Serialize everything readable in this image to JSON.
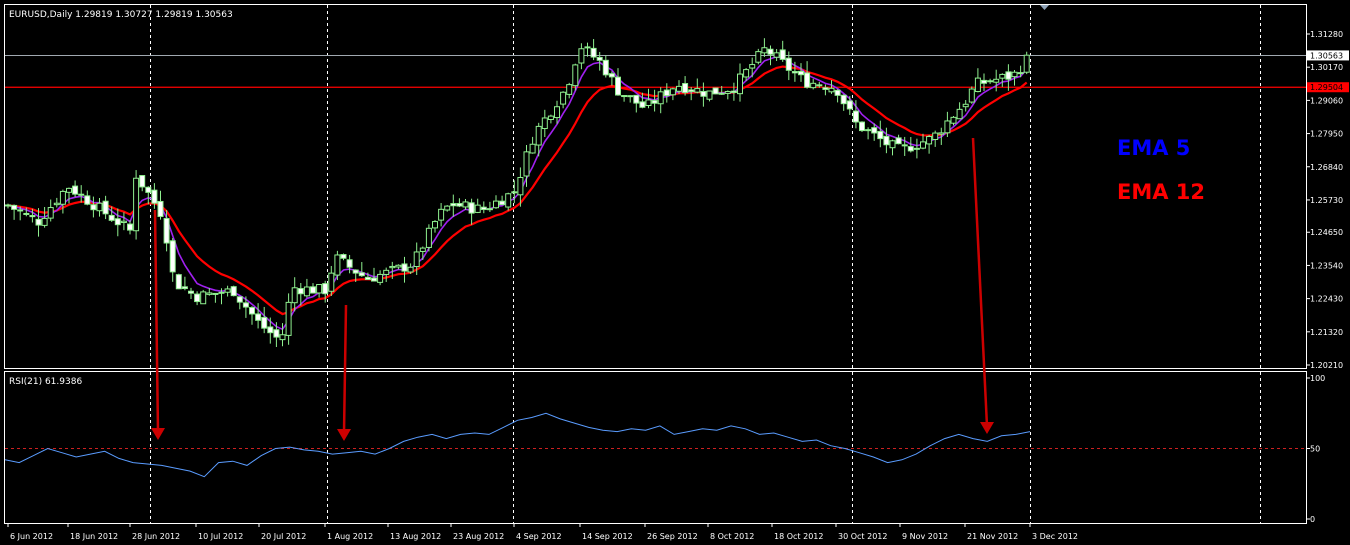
{
  "chart_data": [
    {
      "type": "candlestick",
      "panel": "price",
      "title": "EURUSD,Daily  1.29819 1.30727 1.29819 1.30563",
      "symbol": "EURUSD",
      "timeframe": "Daily",
      "ohlc_header": {
        "open": 1.29819,
        "high": 1.30727,
        "low": 1.29819,
        "close": 1.30563
      },
      "ylim": [
        1.2,
        1.321
      ],
      "yticks": [
        1.2021,
        1.2132,
        1.2243,
        1.2354,
        1.2465,
        1.2573,
        1.2684,
        1.2795,
        1.2906,
        1.3017,
        1.3128
      ],
      "ytick_labels": [
        "1.20210",
        "1.21320",
        "1.22430",
        "1.23540",
        "1.24650",
        "1.25730",
        "1.26840",
        "1.27950",
        "1.29060",
        "1.30170",
        "1.31280"
      ],
      "price_line": {
        "value": 1.30563,
        "label": "1.30563"
      },
      "horizontal_line": {
        "value": 1.295,
        "label": "1.29504",
        "color": "#ff0000"
      },
      "x_labels": [
        "6 Jun 2012",
        "18 Jun 2012",
        "28 Jun 2012",
        "10 Jul 2012",
        "20 Jul 2012",
        "1 Aug 2012",
        "13 Aug 2012",
        "23 Aug 2012",
        "4 Sep 2012",
        "14 Sep 2012",
        "26 Sep 2012",
        "8 Oct 2012",
        "18 Oct 2012",
        "30 Oct 2012",
        "9 Nov 2012",
        "21 Nov 2012",
        "3 Dec 2012"
      ],
      "close_path": [
        [
          "6 Jun 2012",
          1.2555
        ],
        [
          "12 Jun 2012",
          1.25
        ],
        [
          "18 Jun 2012",
          1.262
        ],
        [
          "22 Jun 2012",
          1.256
        ],
        [
          "28 Jun 2012",
          1.247
        ],
        [
          "29 Jun 2012",
          1.266
        ],
        [
          "4 Jul 2012",
          1.252
        ],
        [
          "6 Jul 2012",
          1.23
        ],
        [
          "10 Jul 2012",
          1.225
        ],
        [
          "16 Jul 2012",
          1.227
        ],
        [
          "20 Jul 2012",
          1.216
        ],
        [
          "24 Jul 2012",
          1.21
        ],
        [
          "26 Jul 2012",
          1.228
        ],
        [
          "1 Aug 2012",
          1.227
        ],
        [
          "3 Aug 2012",
          1.238
        ],
        [
          "9 Aug 2012",
          1.231
        ],
        [
          "13 Aug 2012",
          1.233
        ],
        [
          "17 Aug 2012",
          1.236
        ],
        [
          "21 Aug 2012",
          1.252
        ],
        [
          "23 Aug 2012",
          1.256
        ],
        [
          "29 Aug 2012",
          1.254
        ],
        [
          "4 Sep 2012",
          1.26
        ],
        [
          "7 Sep 2012",
          1.279
        ],
        [
          "12 Sep 2012",
          1.295
        ],
        [
          "14 Sep 2012",
          1.309
        ],
        [
          "18 Sep 2012",
          1.303
        ],
        [
          "21 Sep 2012",
          1.294
        ],
        [
          "26 Sep 2012",
          1.288
        ],
        [
          "2 Oct 2012",
          1.296
        ],
        [
          "8 Oct 2012",
          1.293
        ],
        [
          "12 Oct 2012",
          1.295
        ],
        [
          "17 Oct 2012",
          1.308
        ],
        [
          "18 Oct 2012",
          1.306
        ],
        [
          "24 Oct 2012",
          1.297
        ],
        [
          "30 Oct 2012",
          1.295
        ],
        [
          "2 Nov 2012",
          1.283
        ],
        [
          "7 Nov 2012",
          1.276
        ],
        [
          "9 Nov 2012",
          1.274
        ],
        [
          "15 Nov 2012",
          1.278
        ],
        [
          "21 Nov 2012",
          1.29
        ],
        [
          "23 Nov 2012",
          1.296
        ],
        [
          "30 Nov 2012",
          1.299
        ],
        [
          "3 Dec 2012",
          1.3056
        ]
      ],
      "series": [
        {
          "name": "EMA 5",
          "color": "#a020f0"
        },
        {
          "name": "EMA 12",
          "color": "#ff0000"
        }
      ],
      "legend": [
        {
          "label": "EMA 5",
          "color": "#0000ff"
        },
        {
          "label": "EMA 12",
          "color": "#ff0000"
        }
      ]
    },
    {
      "type": "line",
      "panel": "indicator",
      "title": "RSI(21) 61.9386",
      "ylim": [
        0,
        100
      ],
      "yticks": [
        0,
        50,
        100
      ],
      "reference_line": 50,
      "series": [
        {
          "name": "RSI(21)",
          "color": "#5a9cff",
          "values": [
            42,
            40,
            45,
            50,
            47,
            44,
            46,
            48,
            43,
            40,
            39,
            38,
            36,
            34,
            30,
            40,
            41,
            38,
            45,
            50,
            51,
            49,
            48,
            46,
            47,
            48,
            46,
            50,
            55,
            58,
            60,
            57,
            60,
            61,
            60,
            65,
            70,
            72,
            75,
            71,
            68,
            65,
            63,
            62,
            64,
            63,
            66,
            60,
            62,
            64,
            63,
            66,
            64,
            60,
            61,
            58,
            55,
            56,
            52,
            50,
            47,
            44,
            40,
            42,
            46,
            52,
            57,
            60,
            57,
            55,
            59,
            60,
            62
          ]
        }
      ],
      "last_value": 61.9386
    }
  ],
  "annotations": {
    "arrows": [
      {
        "from_date": "29 Jun 2012",
        "to_date": "29 Jun 2012",
        "target": "RSI crosses 50"
      },
      {
        "from_date": "1 Aug 2012",
        "to_date": "1 Aug 2012",
        "target": "RSI crosses 50"
      },
      {
        "from_date": "21 Nov 2012",
        "to_date": "23 Nov 2012",
        "target": "RSI crosses 50"
      }
    ],
    "arrow_color": "#cc0000"
  }
}
